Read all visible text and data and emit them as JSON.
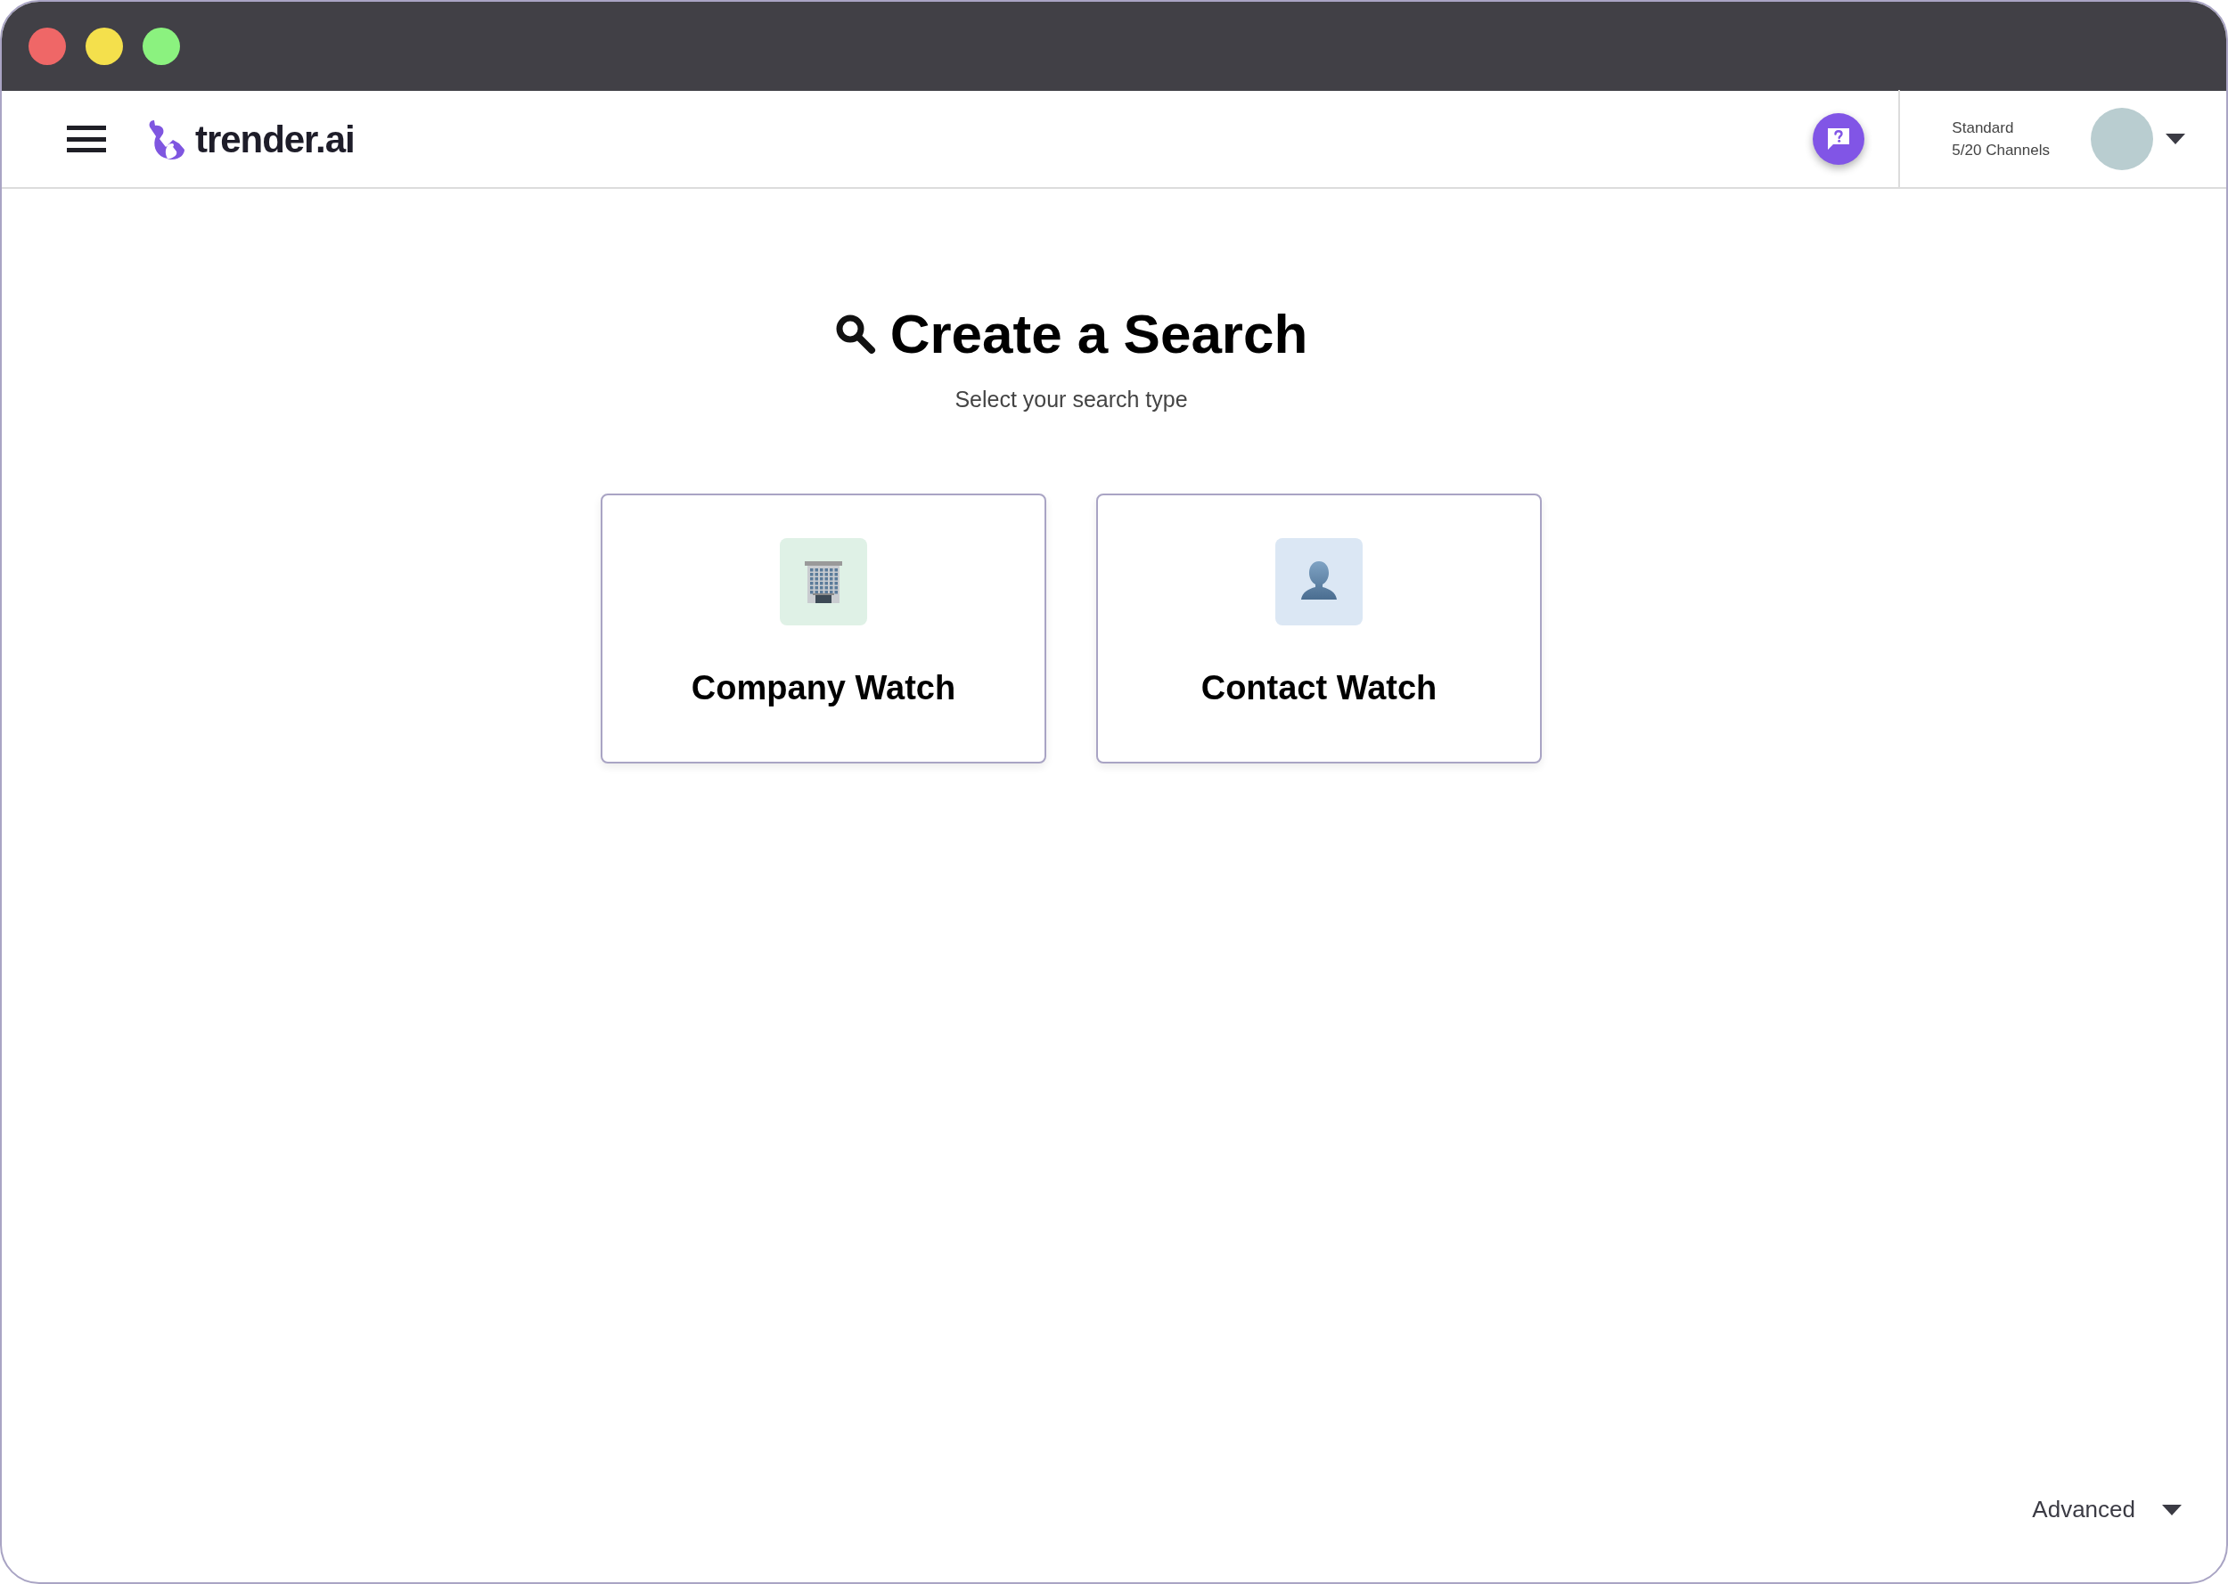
{
  "header": {
    "logo_text": "trender.ai",
    "plan": "Standard",
    "usage": "5/20 Channels"
  },
  "main": {
    "title": "Create a Search",
    "subtitle": "Select your search type"
  },
  "options": [
    {
      "kind": "company",
      "label": "Company Watch"
    },
    {
      "kind": "contact",
      "label": "Contact Watch"
    }
  ],
  "footer": {
    "advanced": "Advanced"
  }
}
